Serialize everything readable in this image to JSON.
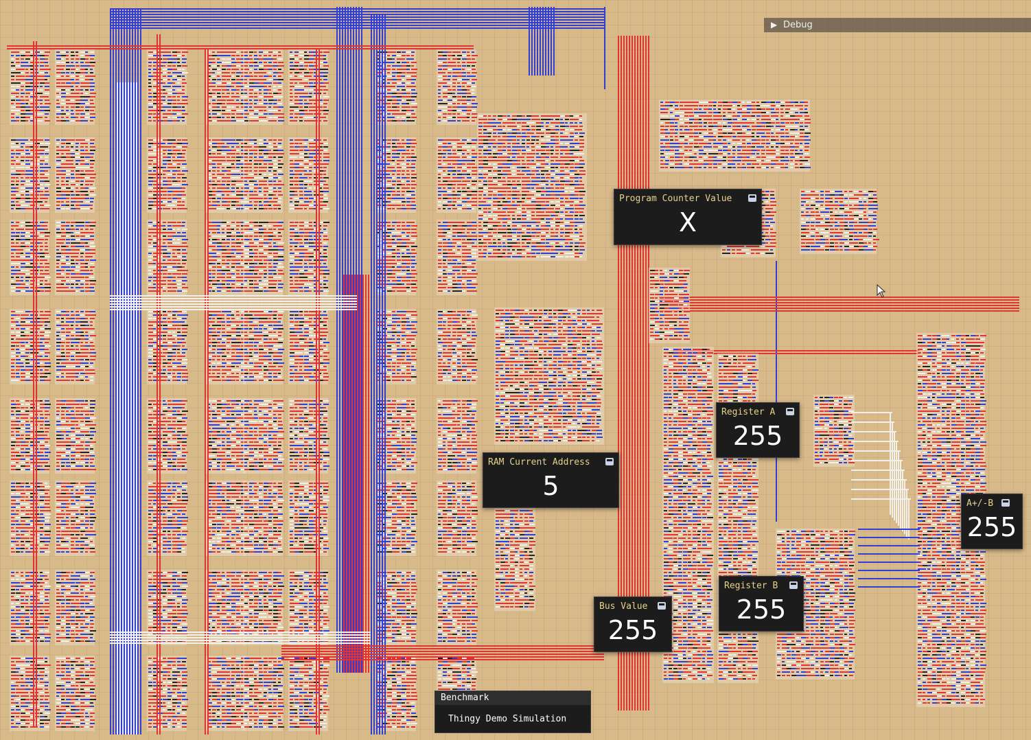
{
  "debug": {
    "label": "Debug",
    "icon": "play-triangle-icon"
  },
  "panels": {
    "pc": {
      "title": "Program Counter Value",
      "value": "X"
    },
    "ram": {
      "title": "RAM Current Address",
      "value": "5"
    },
    "reg_a": {
      "title": "Register A",
      "value": "255"
    },
    "reg_b": {
      "title": "Register B",
      "value": "255"
    },
    "bus": {
      "title": "Bus Value",
      "value": "255"
    },
    "alu": {
      "title": "A+/-B",
      "value": "255"
    }
  },
  "benchmark": {
    "header": "Benchmark",
    "item": "Thingy Demo Simulation"
  },
  "colors": {
    "background": "#d8b98a",
    "wire_on": "#e03434",
    "wire_off": "#2f3fd6",
    "wire_neutral": "#f2f0ea",
    "panel_bg": "#1c1c1c",
    "panel_title": "#e6d38a"
  }
}
